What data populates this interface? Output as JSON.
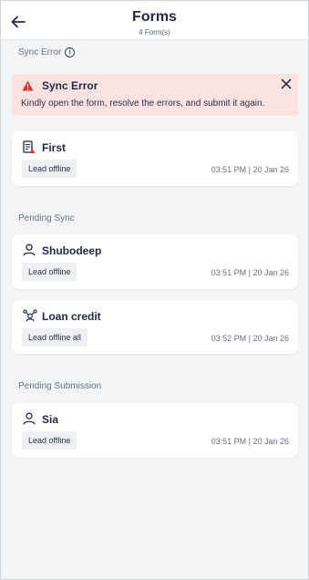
{
  "header": {
    "title": "Forms",
    "subtitle": "4 Form(s)"
  },
  "sections": {
    "sync_error_label": "Sync Error",
    "pending_sync_label": "Pending Sync",
    "pending_submission_label": "Pending Submission"
  },
  "error_banner": {
    "title": "Sync Error",
    "message": "Kindly open the form, resolve the errors, and submit it again."
  },
  "cards": [
    {
      "name": "First",
      "tag": "Lead offline",
      "timestamp": "03:51 PM | 20 Jan 26",
      "icon": "form-error-icon"
    },
    {
      "name": "Shubodeep",
      "tag": "Lead offline",
      "timestamp": "03:51 PM | 20 Jan 26",
      "icon": "person-icon"
    },
    {
      "name": "Loan credit",
      "tag": "Lead offline all",
      "timestamp": "03:52 PM | 20 Jan 26",
      "icon": "people-network-icon"
    },
    {
      "name": "Sia",
      "tag": "Lead offline",
      "timestamp": "03:51 PM | 20 Jan 26",
      "icon": "person-icon"
    }
  ],
  "colors": {
    "error_bg": "#fde2e2",
    "error_accent": "#d9342b",
    "text_primary": "#1f2a44",
    "background": "#f3f4f6"
  }
}
